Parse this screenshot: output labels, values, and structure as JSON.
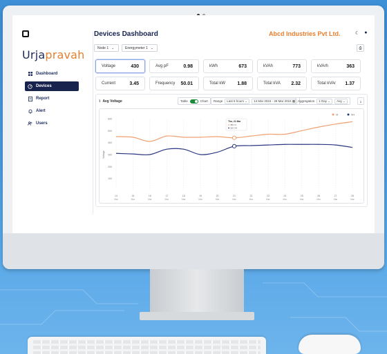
{
  "app": {
    "brand_part1": "Urja",
    "brand_part2": "pravah",
    "title": "Devices Dashboard",
    "company": "Abcd Industries Pvt Ltd."
  },
  "nav": [
    {
      "label": "Dashboard",
      "icon": "grid-icon",
      "active": false
    },
    {
      "label": "Devices",
      "icon": "devices-icon",
      "active": true
    },
    {
      "label": "Report",
      "icon": "report-icon",
      "active": false
    },
    {
      "label": "Alert",
      "icon": "bell-icon",
      "active": false
    },
    {
      "label": "Users",
      "icon": "users-icon",
      "active": false
    }
  ],
  "filters": {
    "node": "Node 1",
    "meter": "Energymeter 1"
  },
  "metrics": [
    {
      "label": "Voltage",
      "value": "430"
    },
    {
      "label": "Avg pF",
      "value": "0.98"
    },
    {
      "label": "kWh",
      "value": "673"
    },
    {
      "label": "kVAh",
      "value": "773"
    },
    {
      "label": "kVArh",
      "value": "363"
    },
    {
      "label": "Current",
      "value": "3.45"
    },
    {
      "label": "Frequency",
      "value": "50.01"
    },
    {
      "label": "Total kW",
      "value": "1.88"
    },
    {
      "label": "Total kVA",
      "value": "2.32"
    },
    {
      "label": "Total kVAr",
      "value": "1.37"
    }
  ],
  "chart_toolbar": {
    "title": "Avg Voltage",
    "table_label": "Table",
    "chart_label": "Chart",
    "range_label": "Range",
    "range_value": "Last 6 hours",
    "date_range": "14 Mar 2024 - 28 Mar 2024",
    "aggregation_label": "Aggregation",
    "agg_period": "1 Day",
    "agg_fn": "Avg"
  },
  "tooltip": {
    "date": "Thu, 21 Mar",
    "line1": "450 VI",
    "line2": "320 VH"
  },
  "colors": {
    "brand_dark": "#17224d",
    "accent_orange": "#e87f2f",
    "series1": "#f0a070",
    "series2": "#2a3580",
    "toggle_green": "#1e8b3a"
  },
  "chart_data": {
    "type": "line",
    "ylabel": "Voltage",
    "ylim": [
      0,
      600
    ],
    "yticks": [
      "600",
      "500",
      "400",
      "300",
      "200",
      "100"
    ],
    "categories": [
      "14 Mar",
      "15 Mar",
      "16 Mar",
      "17 Mar",
      "18 Mar",
      "19 Mar",
      "20 Mar",
      "21 Mar",
      "22 Mar",
      "23 Mar",
      "24 Mar",
      "25 Mar",
      "26 Mar",
      "27 Mar",
      "28 Mar"
    ],
    "series": [
      {
        "name": "VI",
        "color": "#f0a070",
        "values": [
          450,
          445,
          410,
          455,
          445,
          445,
          450,
          440,
          455,
          470,
          470,
          500,
          530,
          555,
          575
        ]
      },
      {
        "name": "VH",
        "color": "#2a3580",
        "values": [
          310,
          305,
          300,
          345,
          345,
          300,
          320,
          370,
          375,
          380,
          385,
          385,
          385,
          380,
          360
        ]
      }
    ],
    "legend": "top-right",
    "highlight_index": 7,
    "grid": true
  }
}
